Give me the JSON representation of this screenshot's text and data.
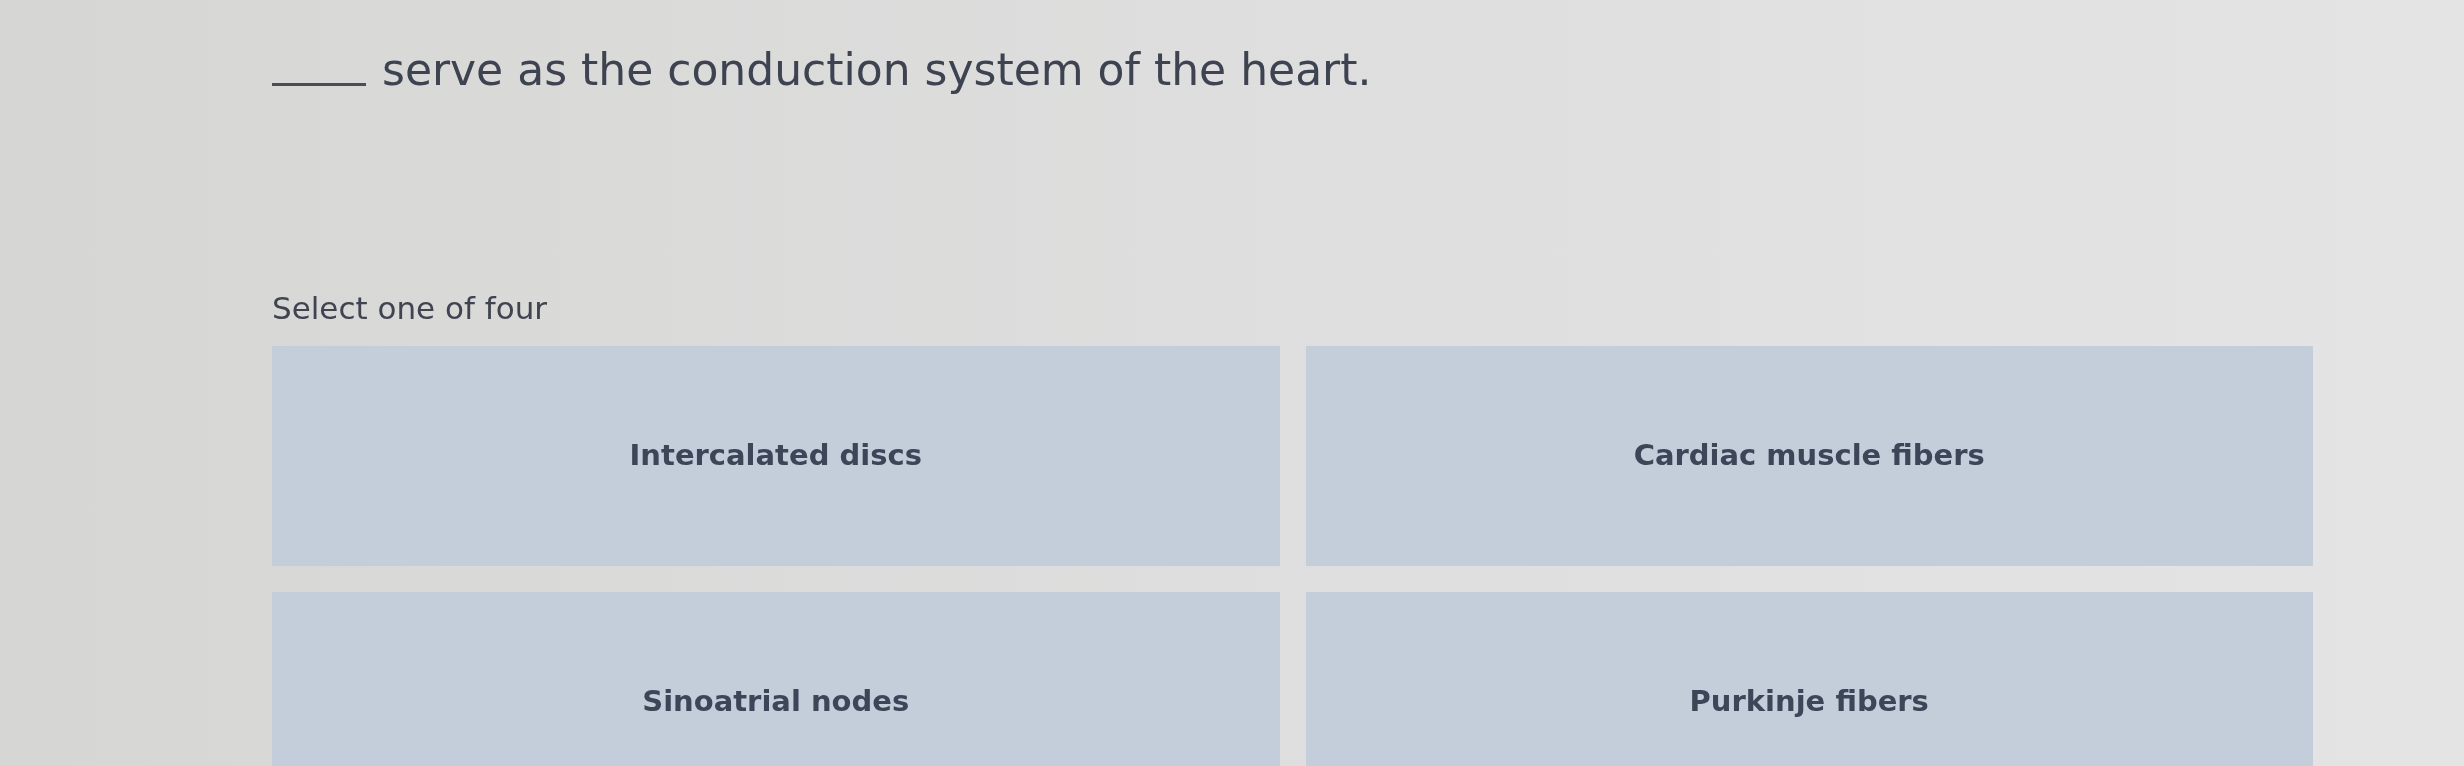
{
  "question": {
    "text": "serve as the conduction system of the heart."
  },
  "instruction": "Select one of four",
  "options": [
    {
      "label": "Intercalated discs",
      "selected": false
    },
    {
      "label": "Cardiac muscle fibers",
      "selected": false
    },
    {
      "label": "Sinoatrial nodes",
      "selected": false
    },
    {
      "label": "Purkinje fibers",
      "selected": false
    }
  ]
}
